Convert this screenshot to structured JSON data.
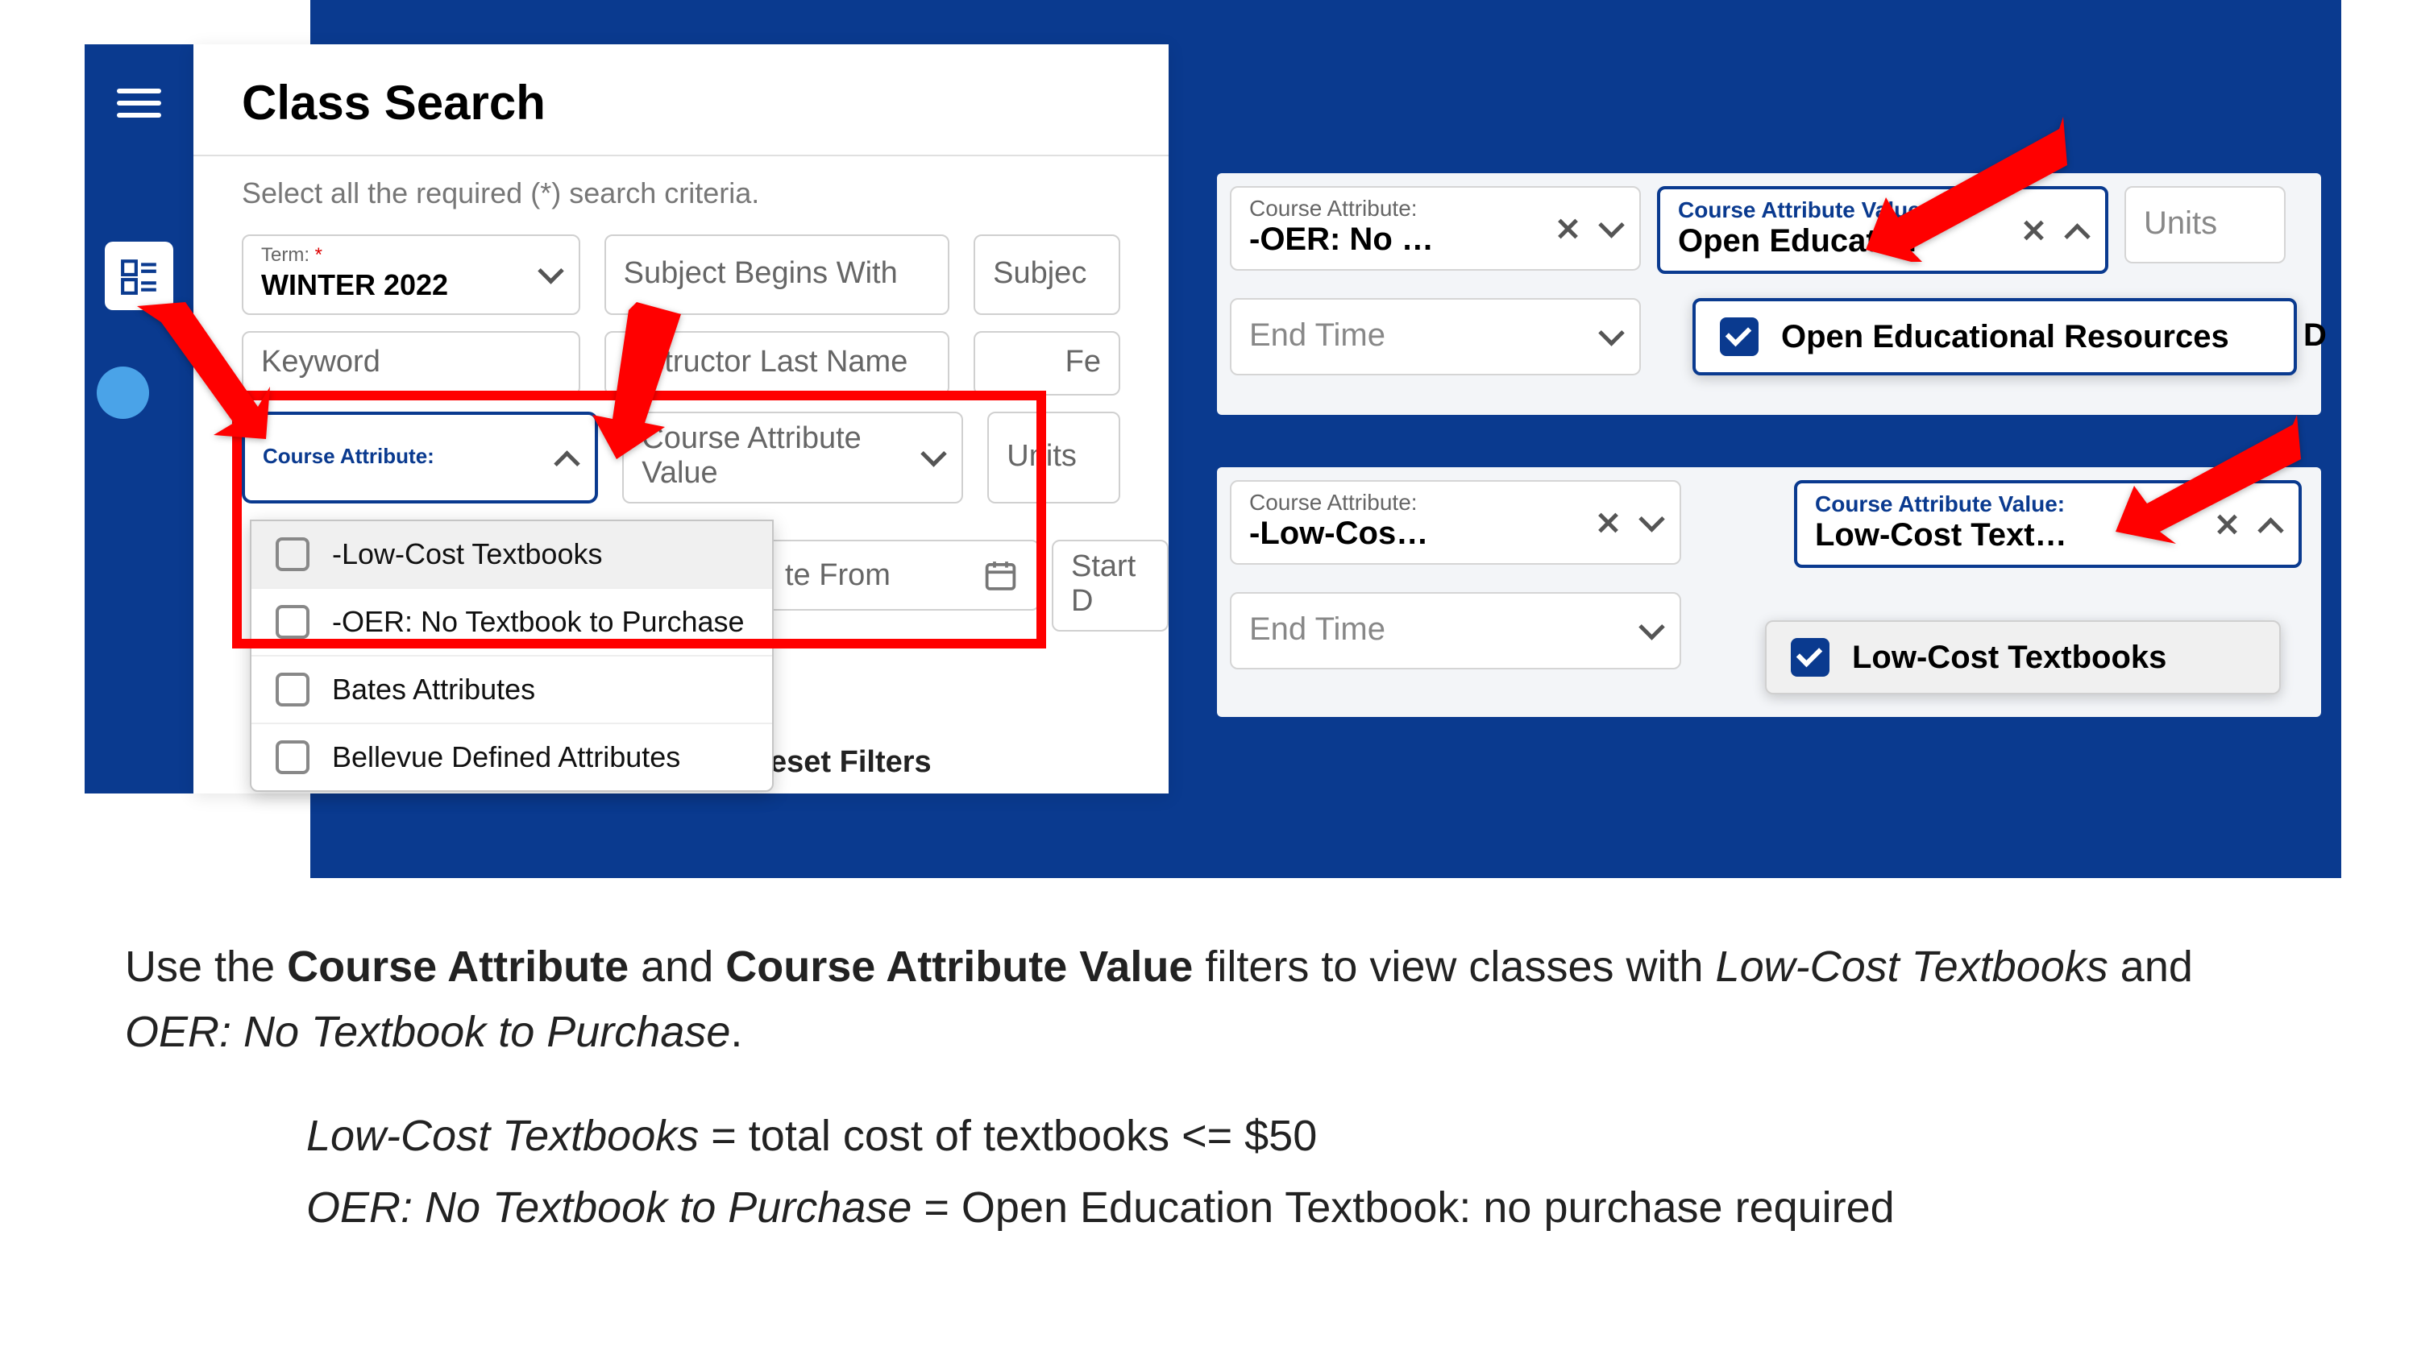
{
  "main": {
    "title": "Class Search",
    "criteria_label": "Select all the required (*) search criteria.",
    "term_label": "Term:",
    "term_required": "*",
    "term_value": "WINTER 2022",
    "subject_begins": "Subject Begins With",
    "subject": "Subjec",
    "keyword": "Keyword",
    "instructor_last_name": "Instructor Last Name",
    "fe": "Fe",
    "course_attribute_label": "Course Attribute:",
    "course_attribute_value_label": "Course Attribute Value",
    "units": "Units",
    "date_from": "te From",
    "start_date": "Start D",
    "reset": "eset Filters"
  },
  "dropdown": {
    "item1": "-Low-Cost Textbooks",
    "item2": "-OER: No Textbook to Purchase",
    "item3": "Bates Attributes",
    "item4": "Bellevue Defined Attributes"
  },
  "right1": {
    "course_attr_label": "Course Attribute:",
    "course_attr_value": "-OER: No …",
    "cav_label": "Course Attribute Value:",
    "cav_value": "Open Educati…",
    "units": "Units",
    "end_time": "End Time",
    "option": "Open Educational Resources",
    "trailing": "D"
  },
  "right2": {
    "course_attr_label": "Course Attribute:",
    "course_attr_value": "-Low-Cos…",
    "cav_label": "Course Attribute Value:",
    "cav_value": "Low-Cost Text…",
    "end_time": "End Time",
    "option": "Low-Cost Textbooks"
  },
  "instruction": {
    "p1a": "Use the ",
    "p1b": "Course Attribute",
    "p1c": " and ",
    "p1d": "Course Attribute Value",
    "p1e": " filters to view classes with ",
    "p1f": "Low-Cost Textbooks",
    "p1g": " and ",
    "p1h": "OER: No Textbook to Purchase",
    "p1i": "."
  },
  "definitions": {
    "lct_label": "Low-Cost Textbooks",
    "lct_def": " = total cost of textbooks <= $50",
    "oer_label": "OER: No Textbook to Purchase",
    "oer_def": " = Open Education Textbook: no purchase required"
  }
}
